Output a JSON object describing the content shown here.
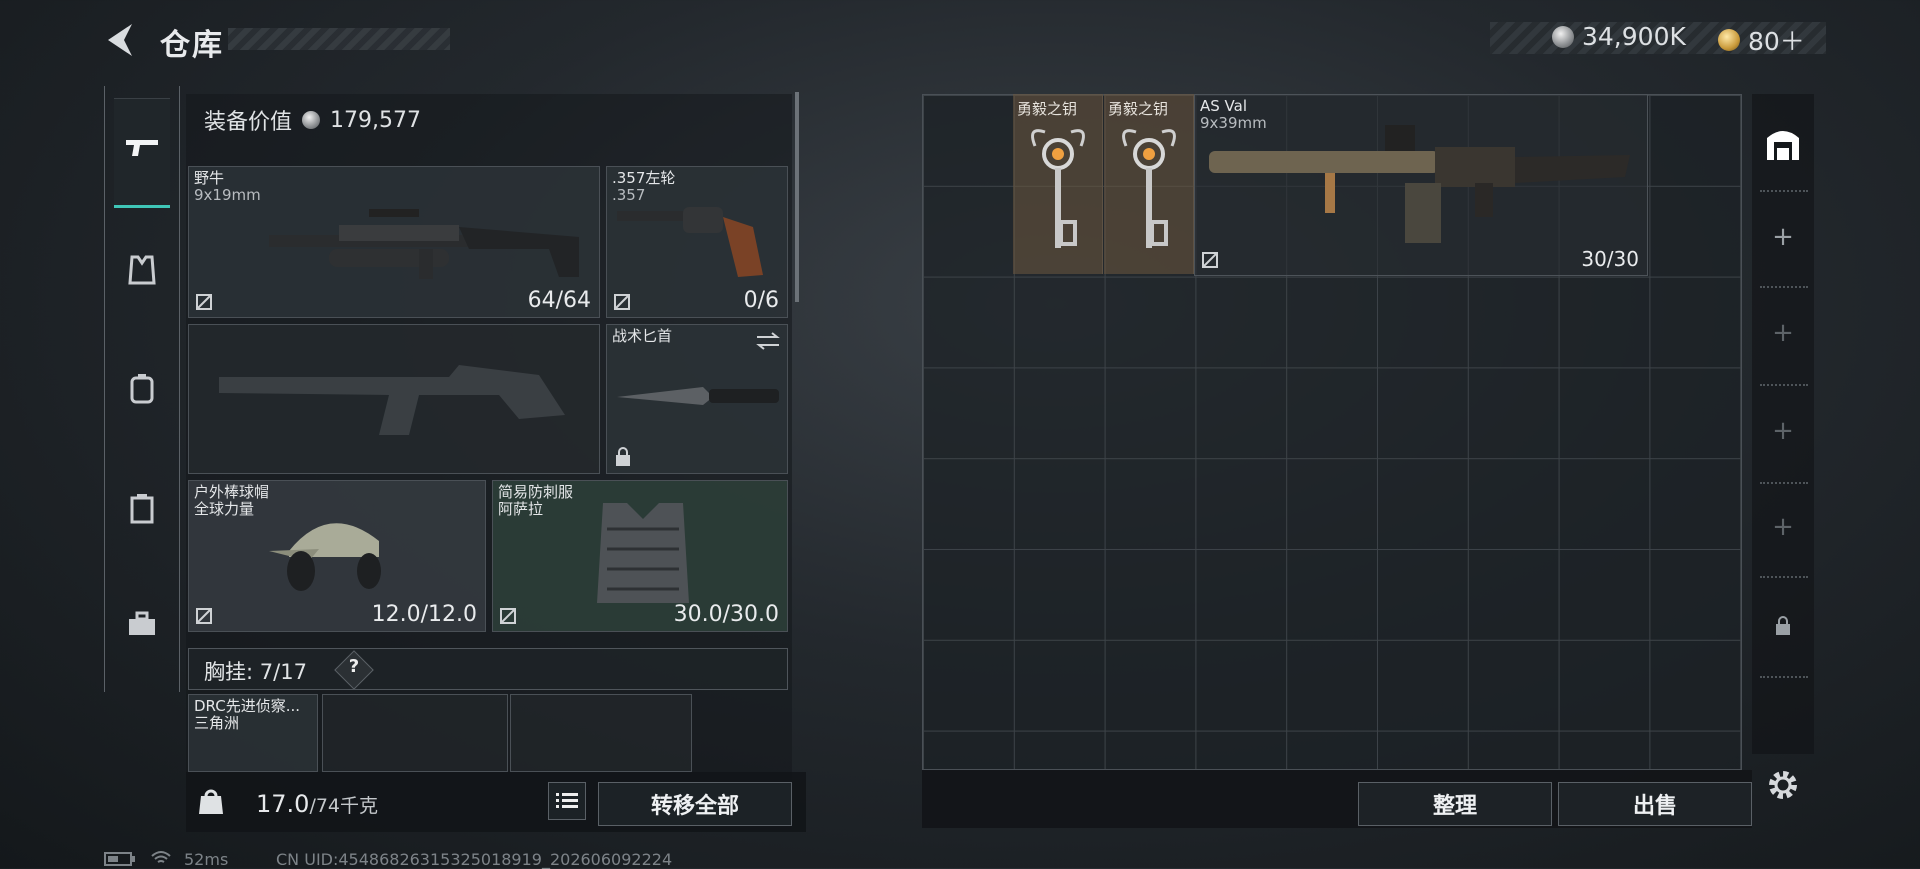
{
  "header": {
    "title": "仓库",
    "coins": "34,900K",
    "tickets": "80＋"
  },
  "left_panel": {
    "value_label": "装备价值",
    "value": "179,577",
    "slots": {
      "primary": {
        "name": "野牛",
        "sub": "9x19mm",
        "count": "64/64"
      },
      "sidearm": {
        "name": ".357左轮",
        "sub": ".357",
        "count": "0/6"
      },
      "melee": {
        "name": "战术匕首"
      },
      "helmet": {
        "name": "户外棒球帽",
        "sub": "全球力量",
        "count": "12.0/12.0"
      },
      "armor": {
        "name": "简易防刺服",
        "sub": "阿萨拉",
        "count": "30.0/30.0"
      },
      "chest_item": {
        "name": "DRC先进侦察...",
        "sub": "三角洲"
      }
    },
    "chest_rig_label": "胸挂:",
    "chest_rig_count": "7/17",
    "help": "?"
  },
  "bottom_left": {
    "weight": "17.0",
    "weight_unit": "/74千克",
    "transfer_all": "转移全部"
  },
  "stash": {
    "items": [
      {
        "name": "勇毅之钥"
      },
      {
        "name": "勇毅之钥"
      },
      {
        "name": "AS Val",
        "sub": "9x39mm",
        "count": "30/30"
      }
    ],
    "organize": "整理",
    "sell": "出售"
  },
  "footer": {
    "ping": "52ms",
    "uid": "CN UID:454868263153250189​19_202606092224"
  },
  "colors": {
    "accent": "#3fc6b7",
    "key_bg": "#6e5840",
    "coin": "#c0c3c6"
  },
  "icons": [
    "back-arrow-icon",
    "pistol-icon",
    "armor-vest-icon",
    "backpack-icon",
    "chest-rig-icon",
    "toolbox-icon",
    "stash-icon",
    "plus-icon",
    "lock-icon",
    "gear-icon",
    "list-icon",
    "weight-icon",
    "swap-icon",
    "no-insure-icon"
  ]
}
